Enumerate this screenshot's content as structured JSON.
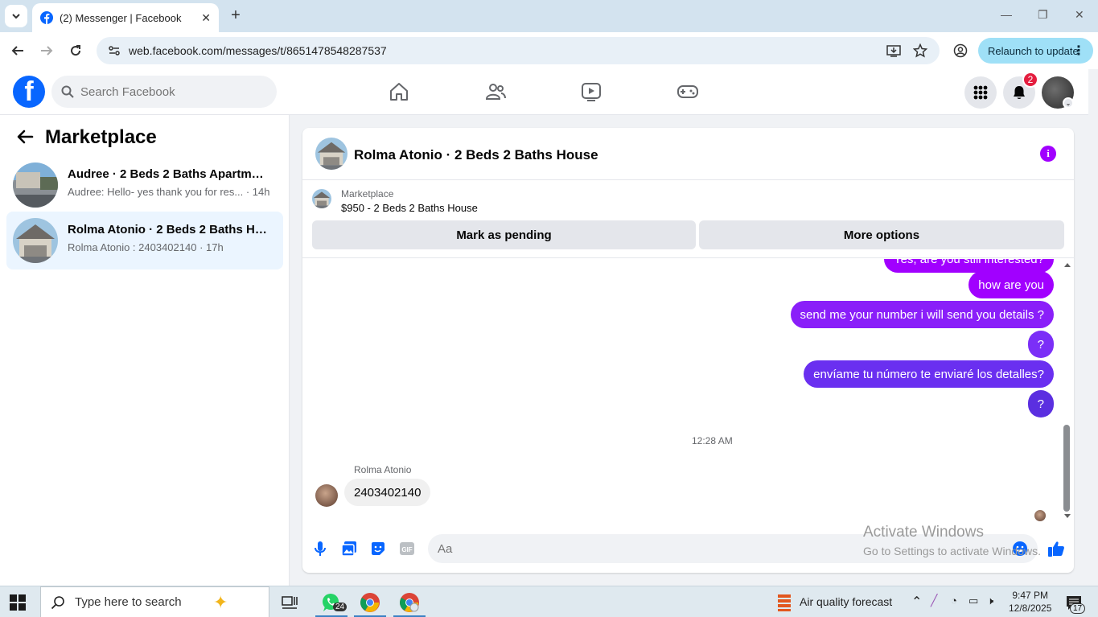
{
  "browser": {
    "tab_title": "(2) Messenger | Facebook",
    "url": "web.facebook.com/messages/t/8651478548287537",
    "relaunch_label": "Relaunch to update"
  },
  "fb_header": {
    "search_placeholder": "Search Facebook",
    "notification_count": "2"
  },
  "sidebar": {
    "title": "Marketplace",
    "conversations": [
      {
        "name": "Audree · 2 Beds 2 Baths Apartmen...",
        "preview": "Audree: Hello- yes thank you for res...",
        "time": "· 14h",
        "active": false
      },
      {
        "name": "Rolma Atonio · 2 Beds 2 Baths Ho...",
        "preview": "Rolma Atonio : 2403402140",
        "time": "· 17h",
        "active": true
      }
    ]
  },
  "chat": {
    "title": "Rolma Atonio · 2 Beds 2 Baths House",
    "listing_label": "Marketplace",
    "listing_price": "$950 - 2 Beds 2 Baths House",
    "mark_pending_label": "Mark as pending",
    "more_options_label": "More options",
    "outgoing_messages": [
      "Yes, are you still interested?",
      "how are you",
      "send me your number i will send you details ?",
      "?",
      "envíame tu número te enviaré los detalles?",
      "?"
    ],
    "timestamp": "12:28 AM",
    "sender_name": "Rolma Atonio",
    "incoming_message": "2403402140",
    "composer_placeholder": "Aa"
  },
  "watermark": {
    "line1": "Activate Windows",
    "line2": "Go to Settings to activate Windows."
  },
  "taskbar": {
    "search_text": "Type here to search",
    "whatsapp_badge": "24",
    "weather_text": "Air quality forecast",
    "time": "9:47 PM",
    "date": "12/8/2025",
    "notification_count": "17"
  },
  "colors": {
    "fb_blue": "#0866ff",
    "bubble_purple": "#a100ff",
    "bubble_violet": "#7b2ff7",
    "bubble_indigo": "#5b2fe0"
  }
}
